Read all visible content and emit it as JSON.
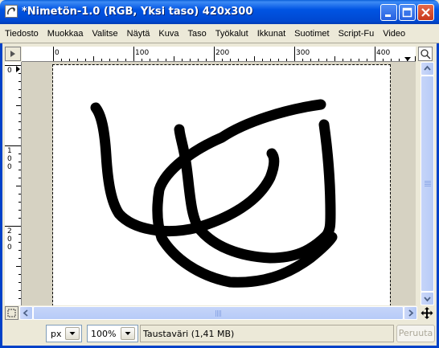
{
  "window": {
    "title": "*Nimetön-1.0 (RGB, Yksi taso) 420x300"
  },
  "menu": {
    "items": [
      "Tiedosto",
      "Muokkaa",
      "Valitse",
      "Näytä",
      "Kuva",
      "Taso",
      "Työkalut",
      "Ikkunat",
      "Suotimet",
      "Script-Fu",
      "Video"
    ]
  },
  "rulers": {
    "horizontal_labels": [
      "0",
      "100",
      "200",
      "300",
      "400"
    ],
    "vertical_labels": [
      "0",
      "100",
      "200"
    ]
  },
  "status": {
    "unit": "px",
    "zoom": "100%",
    "message": "Taustaväri (1,41 MB)",
    "cancel_label": "Peruuta"
  },
  "colors": {
    "titlebar": "#0054e3",
    "canvas_background": "#ffffff",
    "stroke": "#000000"
  }
}
